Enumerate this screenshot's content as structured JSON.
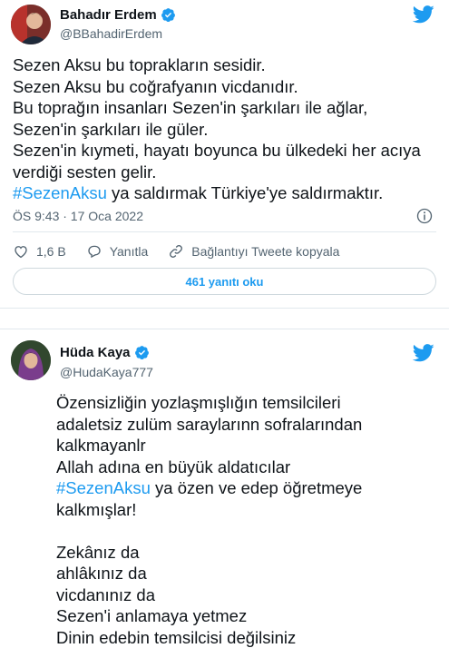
{
  "colors": {
    "accent": "#1d9bf0",
    "text": "#0f1419",
    "muted": "#536471",
    "border": "#e1e8ed"
  },
  "tweet1": {
    "name": "Bahadır Erdem",
    "handle": "@BBahadirErdem",
    "lines": [
      "Sezen Aksu bu toprakların sesidir.",
      "Sezen Aksu bu coğrafyanın vicdanıdır.",
      "Bu toprağın insanları Sezen'in şarkıları ile ağlar,",
      "Sezen'in şarkıları ile güler.",
      "Sezen'in kıymeti, hayatı boyunca bu ülkedeki her acıya",
      "verdiği sesten gelir."
    ],
    "hashtag": "#SezenAksu",
    "hashtag_rest": " ya saldırmak Türkiye'ye saldırmaktır.",
    "timestamp": "ÖS 9:43 · 17 Oca 2022",
    "likes": "1,6 B",
    "reply_label": "Yanıtla",
    "copy_label": "Bağlantıyı Tweete kopyala",
    "read_replies": "461 yanıtı oku"
  },
  "tweet2": {
    "name": "Hüda Kaya",
    "handle": "@HudaKaya777",
    "lines_a": [
      "Özensizliğin yozlaşmışlığın temsilcileri",
      "adaletsiz zulüm saraylarınn sofralarından",
      "kalkmayanlr",
      "Allah adına en büyük aldatıcılar"
    ],
    "hashtag": "#SezenAksu",
    "hashtag_rest": " ya özen ve edep öğretmeye",
    "line_after": "kalkmışlar!",
    "lines_b": [
      "Zekânız da",
      "ahlâkınız da",
      "vicdanınız da",
      "Sezen'i anlamaya yetmez",
      "Dinin edebin temsilcisi değilsiniz"
    ]
  }
}
